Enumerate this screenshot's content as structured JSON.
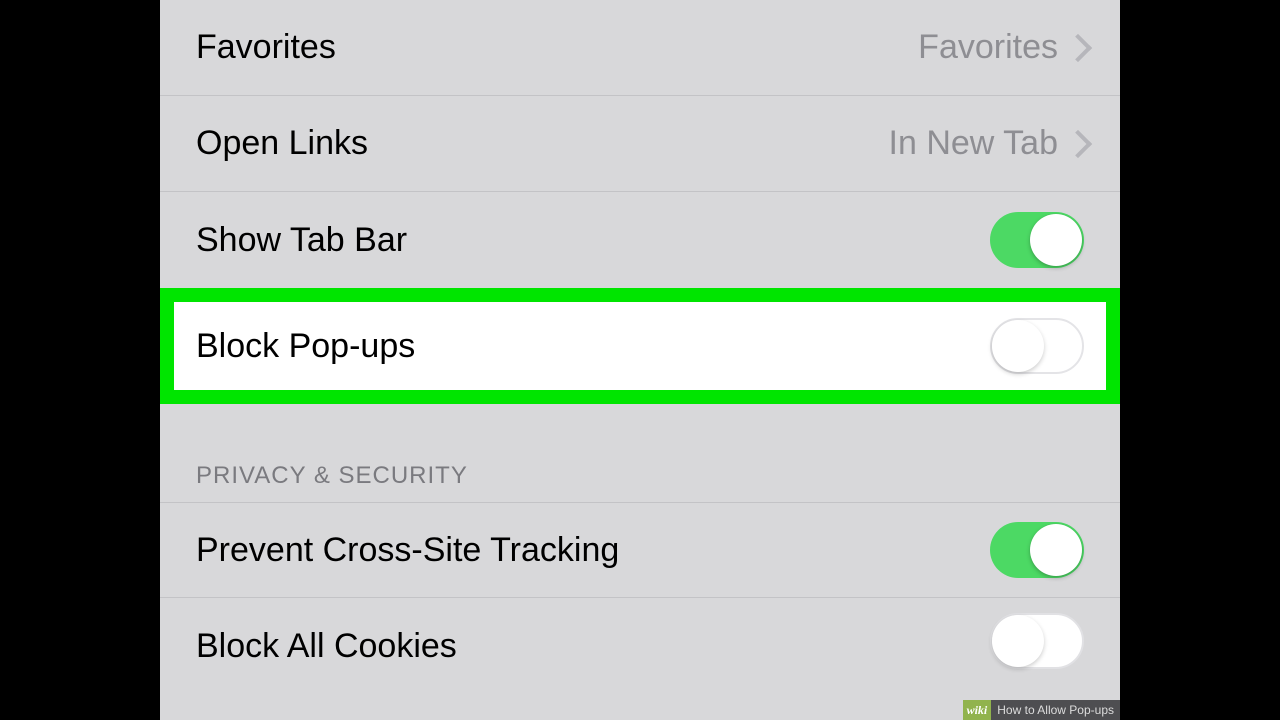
{
  "settings": {
    "favorites": {
      "label": "Favorites",
      "value": "Favorites"
    },
    "open_links": {
      "label": "Open Links",
      "value": "In New Tab"
    },
    "show_tab_bar": {
      "label": "Show Tab Bar",
      "on": true
    },
    "block_popups": {
      "label": "Block Pop-ups",
      "on": false
    }
  },
  "section": {
    "privacy_header": "PRIVACY & SECURITY",
    "prevent_tracking": {
      "label": "Prevent Cross-Site Tracking",
      "on": true
    },
    "block_cookies": {
      "label": "Block All Cookies",
      "on": false
    }
  },
  "watermark": {
    "brand": "wiki",
    "title": "How to Allow Pop-ups"
  }
}
